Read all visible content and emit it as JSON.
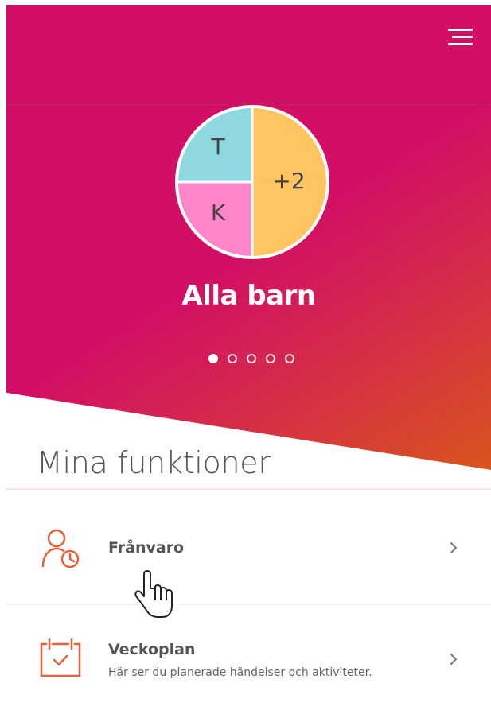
{
  "header": {
    "menu_icon": "hamburger-menu-icon"
  },
  "profile": {
    "segments": [
      {
        "label": "T",
        "color": "#8fd8e0"
      },
      {
        "label": "K",
        "color": "#ff86c8"
      },
      {
        "label": "+2",
        "color": "#ffc562"
      }
    ],
    "title": "Alla barn"
  },
  "carousel": {
    "count": 5,
    "active": 0
  },
  "section": {
    "title": "Mina funktioner"
  },
  "features": [
    {
      "title": "Frånvaro",
      "subtitle": "",
      "icon": "person-clock-icon"
    },
    {
      "title": "Veckoplan",
      "subtitle": "Här ser du planerade händelser och aktiviteter.",
      "icon": "calendar-check-icon"
    }
  ],
  "colors": {
    "brand": "#d30f65",
    "gradient_end": "#d9541d",
    "icon_accent": "#e8613a"
  }
}
